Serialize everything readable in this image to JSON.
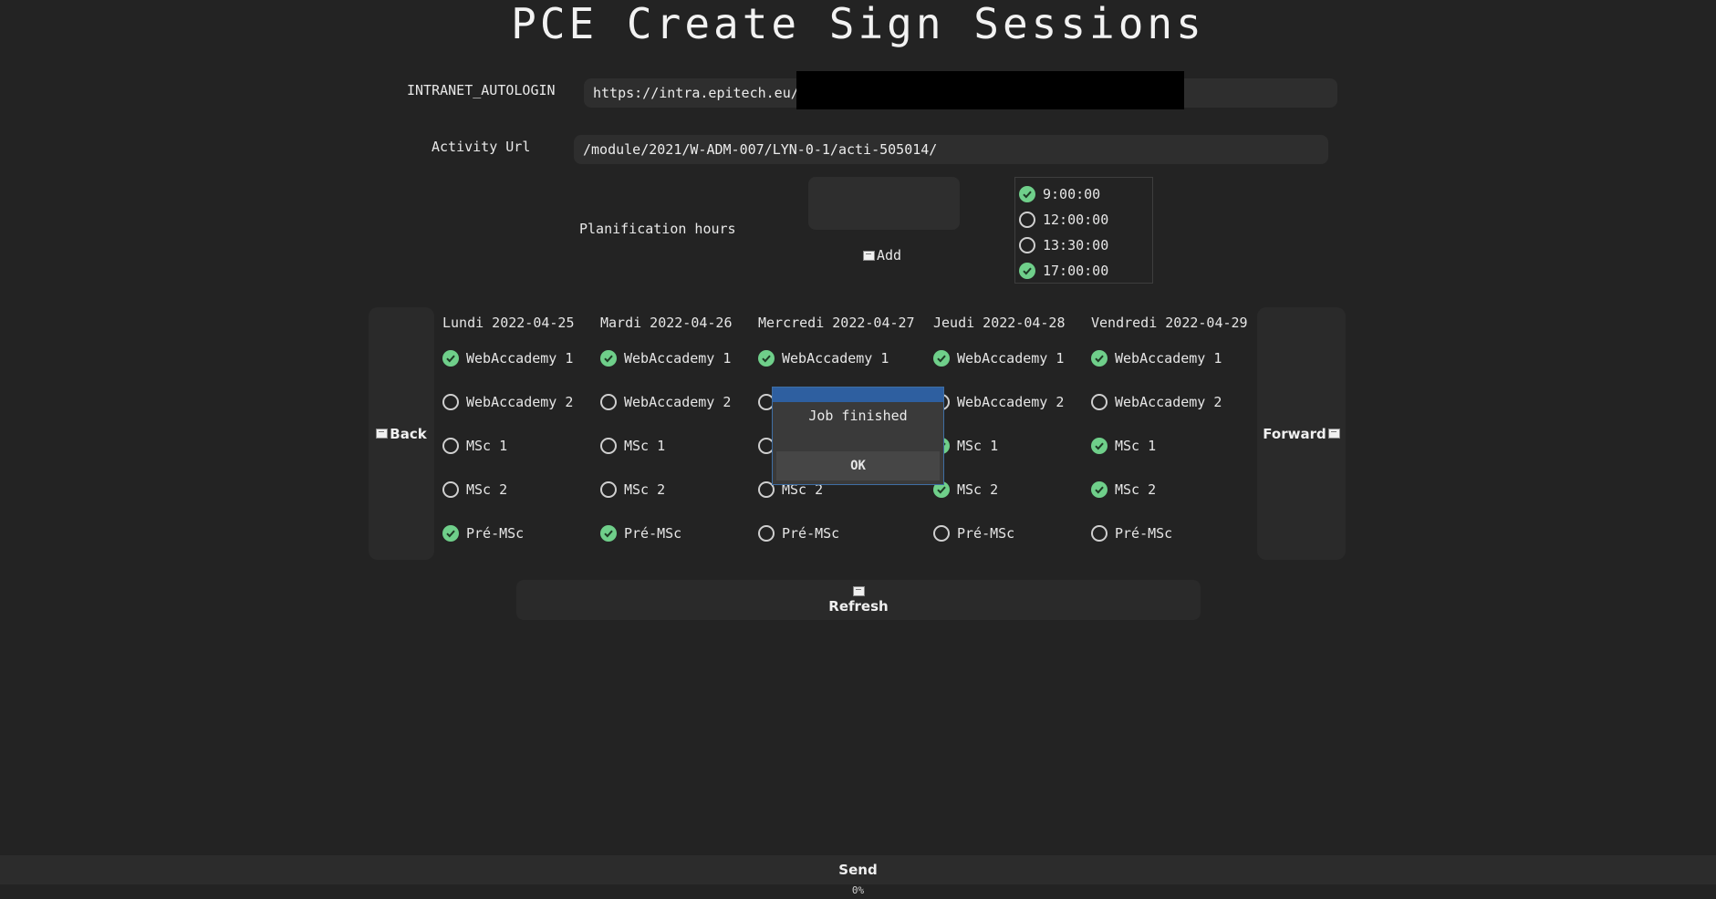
{
  "app": {
    "title": "PCE Create Sign Sessions"
  },
  "form": {
    "autologin_label": "INTRANET_AUTOLOGIN",
    "autologin_value": "https://intra.epitech.eu/",
    "activity_label": "Activity Url",
    "activity_value": "/module/2021/W-ADM-007/LYN-0-1/acti-505014/",
    "planification_label": "Planification hours",
    "add_label": "Add"
  },
  "hours": [
    {
      "label": "9:00:00",
      "checked": true
    },
    {
      "label": "12:00:00",
      "checked": false
    },
    {
      "label": "13:30:00",
      "checked": false
    },
    {
      "label": "17:00:00",
      "checked": true
    }
  ],
  "nav": {
    "back_label": "Back",
    "forward_label": "Forward"
  },
  "days": [
    {
      "label": "Lundi 2022-04-25",
      "sessions": [
        {
          "label": "WebAccademy 1",
          "checked": true
        },
        {
          "label": "WebAccademy 2",
          "checked": false
        },
        {
          "label": "MSc 1",
          "checked": false
        },
        {
          "label": "MSc 2",
          "checked": false
        },
        {
          "label": "Pré-MSc",
          "checked": true
        }
      ]
    },
    {
      "label": "Mardi 2022-04-26",
      "sessions": [
        {
          "label": "WebAccademy 1",
          "checked": true
        },
        {
          "label": "WebAccademy 2",
          "checked": false
        },
        {
          "label": "MSc 1",
          "checked": false
        },
        {
          "label": "MSc 2",
          "checked": false
        },
        {
          "label": "Pré-MSc",
          "checked": true
        }
      ]
    },
    {
      "label": "Mercredi 2022-04-27",
      "sessions": [
        {
          "label": "WebAccademy 1",
          "checked": true
        },
        {
          "label": "WebAccademy 2",
          "checked": false
        },
        {
          "label": "MSc 1",
          "checked": false
        },
        {
          "label": "MSc 2",
          "checked": false
        },
        {
          "label": "Pré-MSc",
          "checked": false
        }
      ]
    },
    {
      "label": "Jeudi 2022-04-28",
      "sessions": [
        {
          "label": "WebAccademy 1",
          "checked": true
        },
        {
          "label": "WebAccademy 2",
          "checked": false
        },
        {
          "label": "MSc 1",
          "checked": true
        },
        {
          "label": "MSc 2",
          "checked": true
        },
        {
          "label": "Pré-MSc",
          "checked": false
        }
      ]
    },
    {
      "label": "Vendredi 2022-04-29",
      "sessions": [
        {
          "label": "WebAccademy 1",
          "checked": true
        },
        {
          "label": "WebAccademy 2",
          "checked": false
        },
        {
          "label": "MSc 1",
          "checked": true
        },
        {
          "label": "MSc 2",
          "checked": true
        },
        {
          "label": "Pré-MSc",
          "checked": false
        }
      ]
    }
  ],
  "refresh_label": "Refresh",
  "dialog": {
    "message": "Job finished",
    "ok_label": "OK"
  },
  "send_label": "Send",
  "progress": {
    "text": "0%",
    "value": 0
  },
  "colors": {
    "background": "#232323",
    "check": "#6fcf8a",
    "dialog_accent": "#2e5fa0"
  }
}
